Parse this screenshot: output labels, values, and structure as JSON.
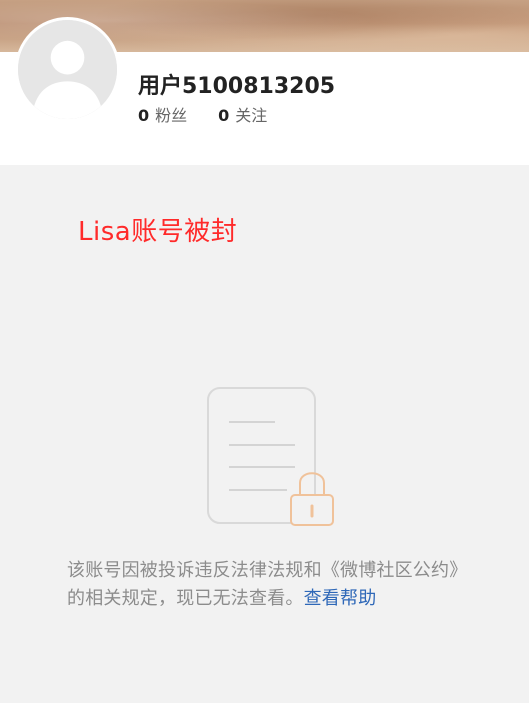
{
  "profile": {
    "username": "用户5100813205",
    "fans": {
      "count": "0",
      "label": "粉丝"
    },
    "following": {
      "count": "0",
      "label": "关注"
    }
  },
  "annotation": {
    "text": "Lisa账号被封",
    "color": "#ff2a2a"
  },
  "notice": {
    "message": "该账号因被投诉违反法律法规和《微博社区公约》的相关规定，现已无法查看。",
    "help_link": "查看帮助",
    "help_link_color": "#2f68b8"
  },
  "icons": {
    "avatar": "default-user-avatar-icon",
    "illustration": "document-lock-icon"
  }
}
